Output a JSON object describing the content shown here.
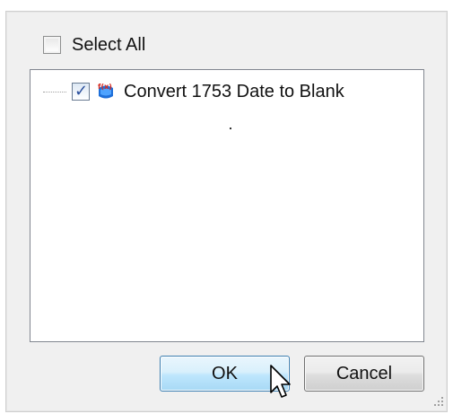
{
  "dialog": {
    "select_all": {
      "label": "Select All",
      "checked": false
    },
    "tree": {
      "items": [
        {
          "label": "Convert 1753 Date to Blank",
          "checked": true,
          "icon": "function-fx-icon"
        }
      ]
    },
    "buttons": {
      "ok_label": "OK",
      "cancel_label": "Cancel"
    }
  },
  "colors": {
    "ok_border": "#3c7fb1",
    "check_mark": "#2a4f9c",
    "fx_icon_blue": "#1e6fd9",
    "fx_icon_red": "#d62a20"
  }
}
